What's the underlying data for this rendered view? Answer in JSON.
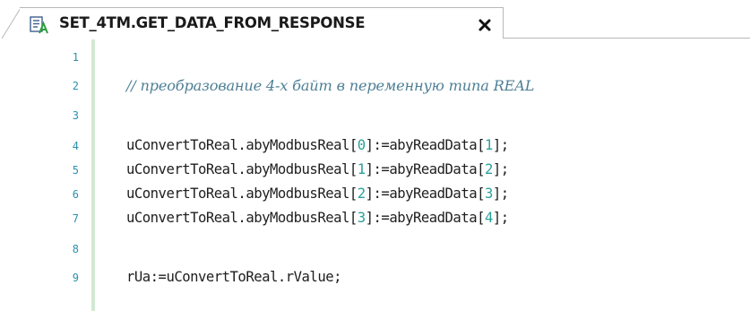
{
  "tab": {
    "title": "SET_4TM.GET_DATA_FROM_RESPONSE",
    "icon": "structured-text-pou-icon",
    "close_icon": "close-icon"
  },
  "editor": {
    "lines": [
      {
        "number": "1",
        "text": ""
      },
      {
        "number": "2",
        "text": "// преобразование 4-х байт в переменную типа REAL"
      },
      {
        "number": "3",
        "text": ""
      },
      {
        "number": "4",
        "text": "uConvertToReal.abyModbusReal[0]:=abyReadData[1];"
      },
      {
        "number": "5",
        "text": "uConvertToReal.abyModbusReal[1]:=abyReadData[2];"
      },
      {
        "number": "6",
        "text": "uConvertToReal.abyModbusReal[2]:=abyReadData[3];"
      },
      {
        "number": "7",
        "text": "uConvertToReal.abyModbusReal[3]:=abyReadData[4];"
      },
      {
        "number": "8",
        "text": ""
      },
      {
        "number": "9",
        "text": "rUa:=uConvertToReal.rValue;"
      }
    ]
  },
  "colors": {
    "line_number": "#2b91af",
    "comment": "#4f7f96",
    "code": "#1e1e1e",
    "number_literal": "#2aa198",
    "gutter_marker": "#d2e8d2"
  }
}
